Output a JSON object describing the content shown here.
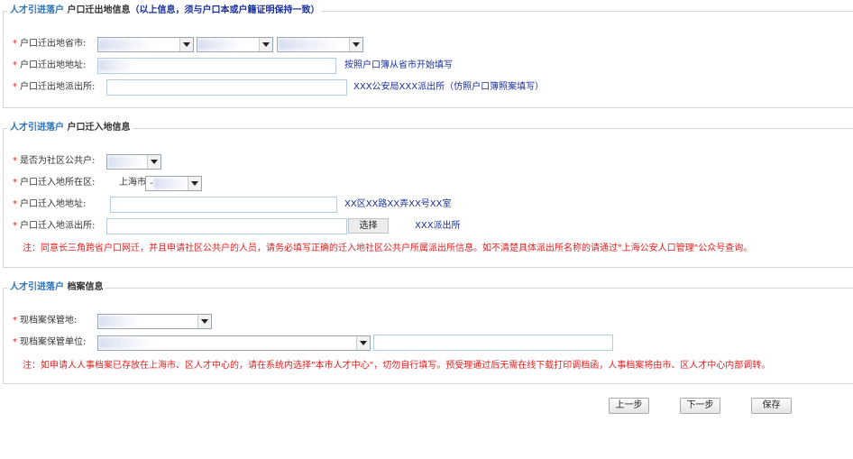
{
  "section1": {
    "legend_prefix": "人才引进落户",
    "legend_title": "户口迁出地信息",
    "legend_note": "（以上信息，须与户口本或户籍证明保持一致）",
    "fields": {
      "province_label": "户口迁出地省市:",
      "address_label": "户口迁出地地址:",
      "address_hint": "按照户口簿从省市开始填写",
      "police_label": "户口迁出地派出所:",
      "police_hint": "XXX公安局XXX派出所（仿照户口簿照案填写）"
    }
  },
  "section2": {
    "legend_prefix": "人才引进落户",
    "legend_title": "户口迁入地信息",
    "fields": {
      "community_label": "是否为社区公共户:",
      "district_label": "户口迁入地所在区:",
      "district_city": "上海市",
      "district_value": "-",
      "address_label": "户口迁入地地址:",
      "address_hint": "XX区XX路XX弄XX号XX室",
      "police_label": "户口迁入地派出所:",
      "select_button": "选择",
      "police_hint": "XXX派出所"
    },
    "note": "注：同意长三角跨省户口网迁，并且申请社区公共户的人员，请务必填写正确的迁入地社区公共户所属派出所信息。如不清楚具体派出所名称的请通过\"上海公安人口管理\"公众号查询。"
  },
  "section3": {
    "legend_prefix": "人才引进落户",
    "legend_title": "档案信息",
    "fields": {
      "archive_place_label": "现档案保管地:",
      "archive_unit_label": "现档案保管单位:"
    },
    "note": "注：如申请人人事档案已存放在上海市、区人才中心的，请在系统内选择\"本市人才中心\"，切勿自行填写。预受理通过后无需在线下载打印调档函，人事档案将由市、区人才中心内部调转。"
  },
  "buttons": {
    "prev": "上一步",
    "next": "下一步",
    "save": "保存"
  },
  "required_mark": "*",
  "colors": {
    "accent_blue": "#2c74b8",
    "hint_navy": "#1a2f9a",
    "required_red": "#e02020",
    "input_border": "#b3cbe0"
  }
}
